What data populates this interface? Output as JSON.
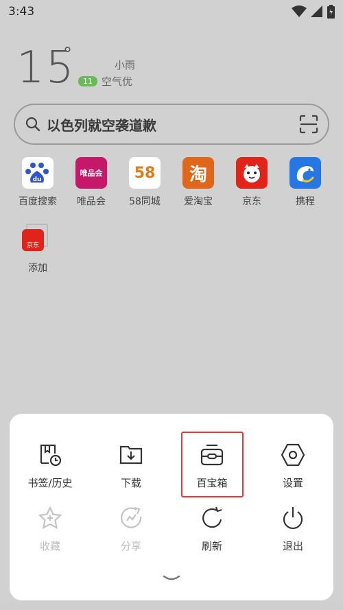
{
  "status": {
    "time": "3:43"
  },
  "weather": {
    "temperature": "15",
    "degree": "°",
    "condition": "小雨",
    "aqi_value": "11",
    "aqi_label": "空气优"
  },
  "search": {
    "text": "以色列就空袭道歉"
  },
  "shortcuts": [
    {
      "label": "百度搜索",
      "icon": "baidu-icon",
      "color": "#ffffff"
    },
    {
      "label": "唯品会",
      "icon": "vip-icon",
      "color": "#c6186a"
    },
    {
      "label": "58同城",
      "icon": "58-icon",
      "color": "#ffffff"
    },
    {
      "label": "爱淘宝",
      "icon": "taobao-icon",
      "color": "#e0661a"
    },
    {
      "label": "京东",
      "icon": "jd-icon",
      "color": "#e2231a"
    },
    {
      "label": "携程",
      "icon": "ctrip-icon",
      "color": "#2577e3"
    },
    {
      "label": "添加",
      "icon": "add-shortcut-icon",
      "color": "#e2231a"
    }
  ],
  "icon_texts": {
    "vip": "唯品会",
    "n58": "58",
    "taobao": "淘",
    "jd_small": "京东"
  },
  "menu": {
    "row1": [
      {
        "label": "书签/历史",
        "icon": "bookmark-history-icon"
      },
      {
        "label": "下载",
        "icon": "download-icon"
      },
      {
        "label": "百宝箱",
        "icon": "toolbox-icon"
      },
      {
        "label": "设置",
        "icon": "settings-icon"
      }
    ],
    "row2": [
      {
        "label": "收藏",
        "icon": "favorite-icon",
        "disabled": true
      },
      {
        "label": "分享",
        "icon": "share-icon",
        "disabled": true
      },
      {
        "label": "刷新",
        "icon": "refresh-icon"
      },
      {
        "label": "退出",
        "icon": "power-icon"
      }
    ]
  },
  "colors": {
    "accent_red": "#e23b3b",
    "aqi_green": "#6ab957",
    "overlay_gray": "#d1d1d1"
  }
}
